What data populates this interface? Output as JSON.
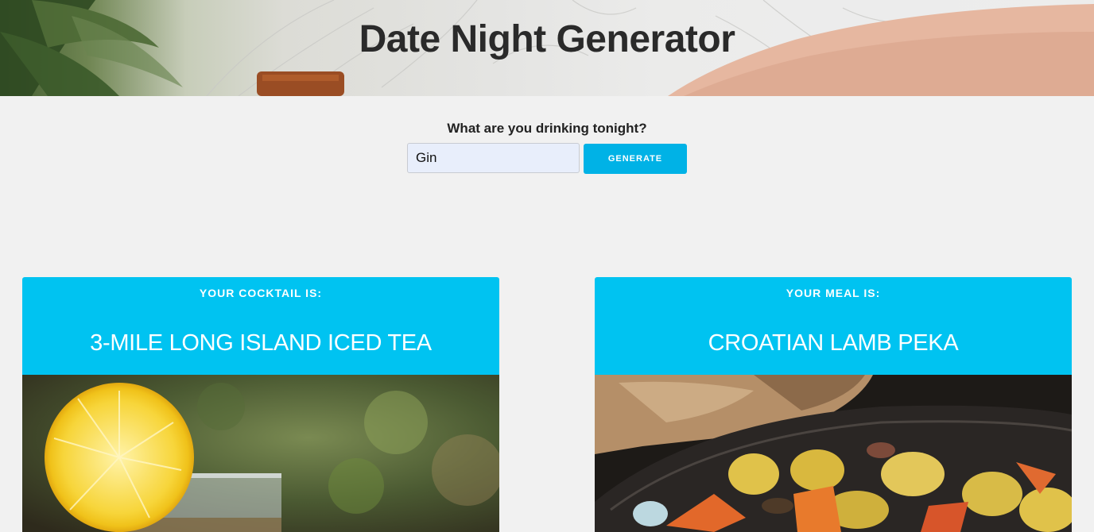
{
  "header": {
    "title": "Date Night Generator"
  },
  "form": {
    "label": "What are you drinking tonight?",
    "input_value": "Gin",
    "generate_label": "GENERATE"
  },
  "cocktail": {
    "kicker": "YOUR COCKTAIL IS:",
    "name": "3-MILE LONG ISLAND ICED TEA",
    "image": "iced-tea-with-lemon-photo"
  },
  "meal": {
    "kicker": "YOUR MEAL IS:",
    "name": "CROATIAN LAMB PEKA",
    "image": "roasted-lamb-and-vegetables-photo"
  },
  "colors": {
    "accent": "#00c3f1",
    "button": "#00b2e6",
    "background": "#f1f1f1",
    "input_bg": "#e8eefb"
  }
}
